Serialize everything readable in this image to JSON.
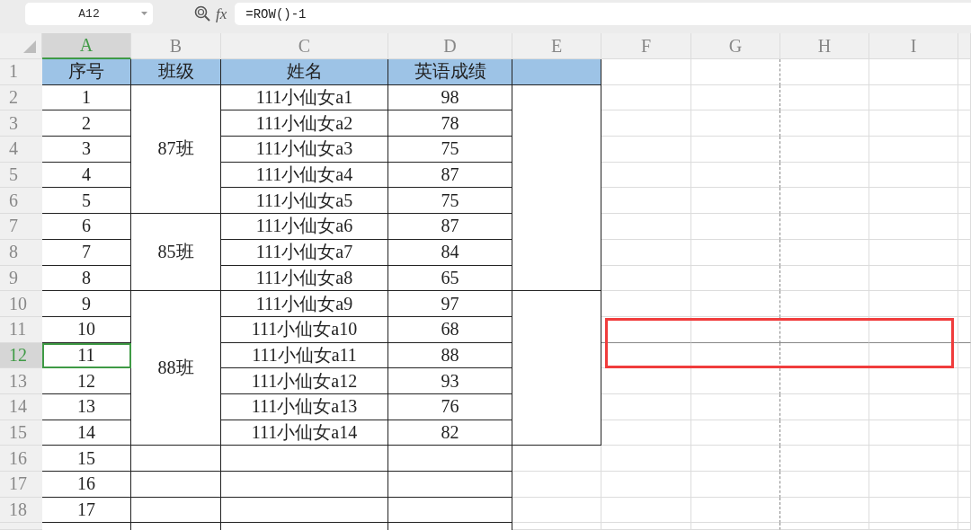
{
  "name_box": "A12",
  "formula_label": "fx",
  "formula": "=ROW()-1",
  "columns": [
    {
      "label": "A",
      "selected": true
    },
    {
      "label": "B",
      "selected": false
    },
    {
      "label": "C",
      "selected": false
    },
    {
      "label": "D",
      "selected": false
    },
    {
      "label": "E",
      "selected": false
    },
    {
      "label": "F",
      "selected": false
    },
    {
      "label": "G",
      "selected": false
    },
    {
      "label": "H",
      "selected": false
    },
    {
      "label": "I",
      "selected": false
    }
  ],
  "rows": [
    {
      "label": "1",
      "selected": false
    },
    {
      "label": "2",
      "selected": false
    },
    {
      "label": "3",
      "selected": false
    },
    {
      "label": "4",
      "selected": false
    },
    {
      "label": "5",
      "selected": false
    },
    {
      "label": "6",
      "selected": false
    },
    {
      "label": "7",
      "selected": false
    },
    {
      "label": "8",
      "selected": false
    },
    {
      "label": "9",
      "selected": false
    },
    {
      "label": "10",
      "selected": false
    },
    {
      "label": "11",
      "selected": false
    },
    {
      "label": "12",
      "selected": true
    },
    {
      "label": "13",
      "selected": false
    },
    {
      "label": "14",
      "selected": false
    },
    {
      "label": "15",
      "selected": false
    },
    {
      "label": "16",
      "selected": false
    },
    {
      "label": "17",
      "selected": false
    },
    {
      "label": "18",
      "selected": false
    }
  ],
  "table_header": [
    "序号",
    "班级",
    "姓名",
    "英语成绩"
  ],
  "classes": [
    {
      "label": "87班",
      "students": [
        {
          "no": "1",
          "name": "111小仙女a1",
          "score": "98",
          "selected": false
        },
        {
          "no": "2",
          "name": "111小仙女a2",
          "score": "78",
          "selected": false
        },
        {
          "no": "3",
          "name": "111小仙女a3",
          "score": "75",
          "selected": false
        },
        {
          "no": "4",
          "name": "111小仙女a4",
          "score": "87",
          "selected": false
        },
        {
          "no": "5",
          "name": "111小仙女a5",
          "score": "75",
          "selected": false
        }
      ]
    },
    {
      "label": "85班",
      "students": [
        {
          "no": "6",
          "name": "111小仙女a6",
          "score": "87",
          "selected": false
        },
        {
          "no": "7",
          "name": "111小仙女a7",
          "score": "84",
          "selected": false
        },
        {
          "no": "8",
          "name": "111小仙女a8",
          "score": "65",
          "selected": false
        }
      ]
    },
    {
      "label": "88班",
      "students": [
        {
          "no": "9",
          "name": "111小仙女a9",
          "score": "97",
          "selected": false
        },
        {
          "no": "10",
          "name": "111小仙女a10",
          "score": "68",
          "selected": false
        },
        {
          "no": "11",
          "name": "111小仙女a11",
          "score": "88",
          "selected": true
        },
        {
          "no": "12",
          "name": "111小仙女a12",
          "score": "93",
          "selected": false
        },
        {
          "no": "13",
          "name": "111小仙女a13",
          "score": "76",
          "selected": false
        },
        {
          "no": "14",
          "name": "111小仙女a14",
          "score": "82",
          "selected": false
        }
      ]
    }
  ],
  "extra_rows": [
    {
      "no": "15",
      "selected": false
    },
    {
      "no": "16",
      "selected": false
    },
    {
      "no": "17",
      "selected": false
    }
  ]
}
